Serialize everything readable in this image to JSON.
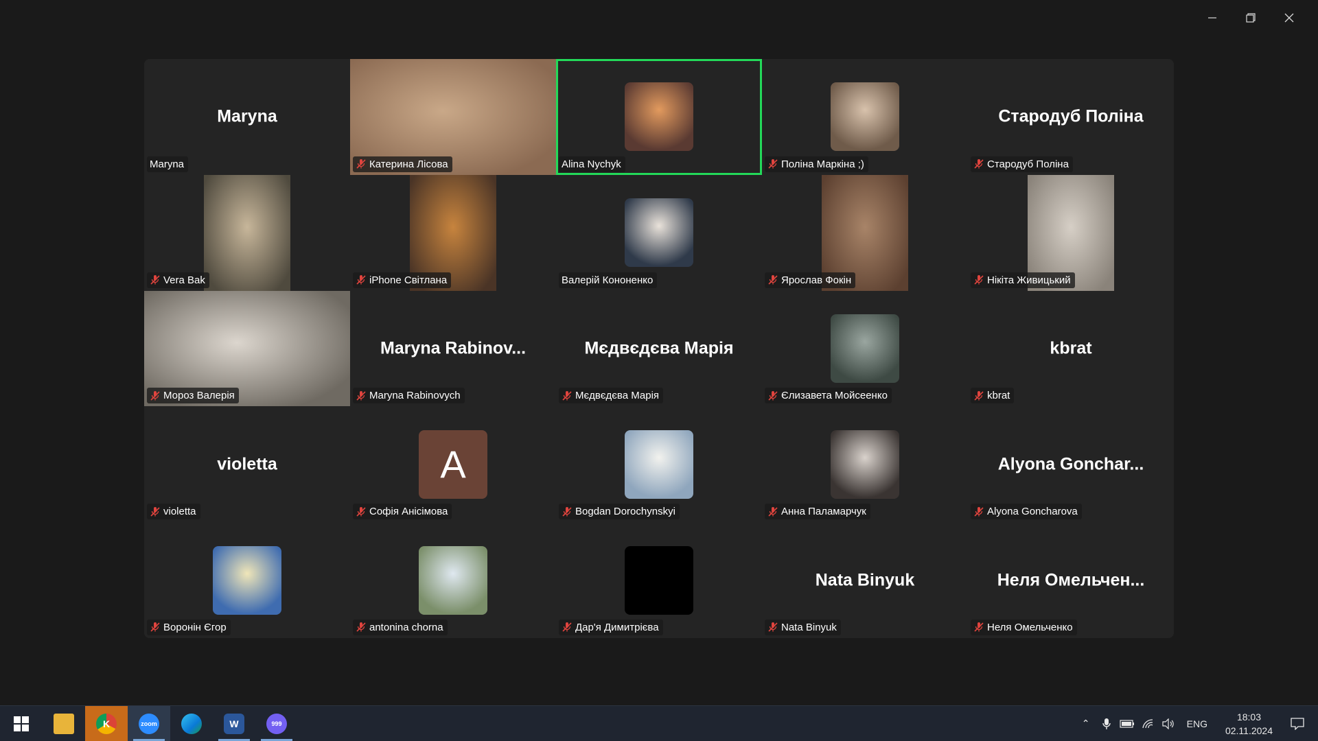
{
  "participants": [
    {
      "display": "Maryna",
      "label": "Maryna",
      "muted": false,
      "kind": "name"
    },
    {
      "display": "",
      "label": "Катерина Лісова",
      "muted": true,
      "kind": "video-full",
      "tone": [
        "#8b6a52",
        "#c9a888"
      ]
    },
    {
      "display": "",
      "label": "Alina Nychyk",
      "muted": false,
      "kind": "avatar",
      "tone": [
        "#5a3a32",
        "#e29a5e"
      ],
      "active": true
    },
    {
      "display": "",
      "label": "Поліна Маркіна ;)",
      "muted": true,
      "kind": "avatar",
      "tone": [
        "#6f5b4a",
        "#d8c2ac"
      ]
    },
    {
      "display": "Стародуб Поліна",
      "label": "Стародуб Поліна",
      "muted": true,
      "kind": "name"
    },
    {
      "display": "",
      "label": "Vera Bak",
      "muted": true,
      "kind": "video-part",
      "tone": [
        "#4f4a3e",
        "#c7b69a"
      ]
    },
    {
      "display": "",
      "label": "iPhone Світлана",
      "muted": true,
      "kind": "video-part",
      "tone": [
        "#4a3426",
        "#c7843e"
      ]
    },
    {
      "display": "",
      "label": "Валерій Кононенко",
      "muted": false,
      "kind": "avatar",
      "tone": [
        "#2f3a4a",
        "#e9e2da"
      ]
    },
    {
      "display": "",
      "label": "Ярослав Фокін",
      "muted": true,
      "kind": "video-part",
      "tone": [
        "#5c4030",
        "#a88468"
      ]
    },
    {
      "display": "",
      "label": "Нікіта Живицький",
      "muted": true,
      "kind": "video-part",
      "tone": [
        "#8a837a",
        "#d6cfc6"
      ]
    },
    {
      "display": "",
      "label": "Мороз Валерія",
      "muted": true,
      "kind": "video-full",
      "tone": [
        "#6f6a62",
        "#dcd6ce"
      ]
    },
    {
      "display": "Maryna  Rabinov...",
      "label": "Maryna Rabinovych",
      "muted": true,
      "kind": "name"
    },
    {
      "display": "Мєдвєдєва Марія",
      "label": "Мєдвєдєва Марія",
      "muted": true,
      "kind": "name"
    },
    {
      "display": "",
      "label": "Єлизавета Мойсеенко",
      "muted": true,
      "kind": "avatar",
      "tone": [
        "#3e4a44",
        "#9aa6a0"
      ]
    },
    {
      "display": "kbrat",
      "label": "kbrat",
      "muted": true,
      "kind": "name"
    },
    {
      "display": "violetta",
      "label": "violetta",
      "muted": true,
      "kind": "name"
    },
    {
      "display": "A",
      "label": "Софія Анісімова",
      "muted": true,
      "kind": "letter",
      "bg": "#6a4336"
    },
    {
      "display": "",
      "label": "Bogdan Dorochynskyi",
      "muted": true,
      "kind": "avatar",
      "tone": [
        "#8fa6bd",
        "#f2f2ee"
      ]
    },
    {
      "display": "",
      "label": "Анна Паламарчук",
      "muted": true,
      "kind": "avatar",
      "tone": [
        "#3a3432",
        "#d9d2cc"
      ]
    },
    {
      "display": "Alyona  Gonchar...",
      "label": "Alyona Goncharova",
      "muted": true,
      "kind": "name"
    },
    {
      "display": "",
      "label": "Воронін Єгор",
      "muted": true,
      "kind": "avatar",
      "tone": [
        "#3f6cb0",
        "#f0e6b8"
      ]
    },
    {
      "display": "",
      "label": "antonina chorna",
      "muted": true,
      "kind": "avatar",
      "tone": [
        "#7b8f6a",
        "#dfe8f0"
      ]
    },
    {
      "display": "",
      "label": "Дар'я Димитрієва",
      "muted": true,
      "kind": "avatar",
      "tone": [
        "#000000",
        "#000000"
      ]
    },
    {
      "display": "Nata Binyuk",
      "label": "Nata Binyuk",
      "muted": true,
      "kind": "name"
    },
    {
      "display": "Неля  Омельчен...",
      "label": "Неля Омельченко",
      "muted": true,
      "kind": "name"
    }
  ],
  "taskbar": {
    "apps": [
      {
        "name": "file-explorer",
        "glyph": "",
        "color": "#e8b43a"
      },
      {
        "name": "chrome",
        "glyph": "K",
        "color": "#1f1f1f"
      },
      {
        "name": "zoom",
        "glyph": "zoom",
        "color": "#2d8cff"
      },
      {
        "name": "edge",
        "glyph": "",
        "color": "#0a7ad6"
      },
      {
        "name": "word",
        "glyph": "W",
        "color": "#2b579a"
      },
      {
        "name": "viber",
        "glyph": "999",
        "color": "#7360f2"
      }
    ],
    "lang": "ENG",
    "time": "18:03",
    "date": "02.11.2024"
  },
  "colors": {
    "active_border": "#23d959",
    "muted_icon": "#e0443e"
  }
}
